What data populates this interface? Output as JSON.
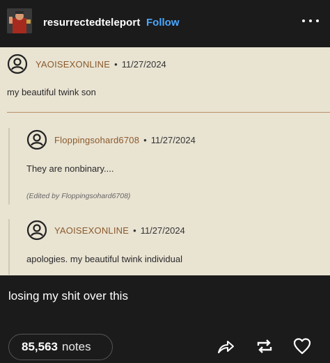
{
  "post": {
    "username": "resurrectedteleport",
    "follow_label": "Follow",
    "caption": "losing my shit over this",
    "notes_count": "85,563",
    "notes_label": "notes"
  },
  "screenshot": {
    "comments": [
      {
        "username": "YAOISEXONLINE",
        "date": "11/27/2024",
        "text": "my beautiful twink son"
      },
      {
        "username": "Floppingsohard6708",
        "date": "11/27/2024",
        "text": "They are nonbinary....",
        "edited": "(Edited by Floppingsohard6708)"
      },
      {
        "username": "YAOISEXONLINE",
        "date": "11/27/2024",
        "text": "apologies. my beautiful twink individual"
      }
    ],
    "separator": "•"
  },
  "icons": {
    "more": "more-dots-icon",
    "share": "share-icon",
    "reblog": "reblog-icon",
    "like": "heart-icon",
    "user": "user-circle-icon"
  },
  "colors": {
    "background": "#1b1b1b",
    "follow": "#4aa8ff",
    "panel": "#e9e3d2",
    "username": "#8a5a2b"
  }
}
